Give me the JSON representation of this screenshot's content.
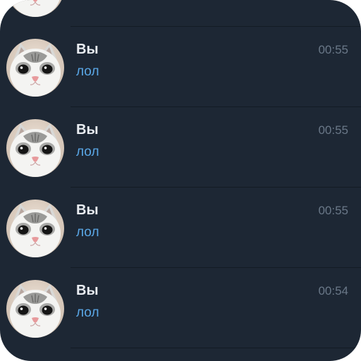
{
  "colors": {
    "background": "#1d2734",
    "name": "#e9edf2",
    "message": "#5aa7e6",
    "time": "#6a7888",
    "divider": "#131b24"
  },
  "avatar_icon": "cat-face-avatar",
  "chats": [
    {
      "name": "Вы",
      "message": "лол",
      "time": "00:55"
    },
    {
      "name": "Вы",
      "message": "лол",
      "time": "00:55"
    },
    {
      "name": "Вы",
      "message": "лол",
      "time": "00:55"
    },
    {
      "name": "Вы",
      "message": "лол",
      "time": "00:54"
    }
  ]
}
